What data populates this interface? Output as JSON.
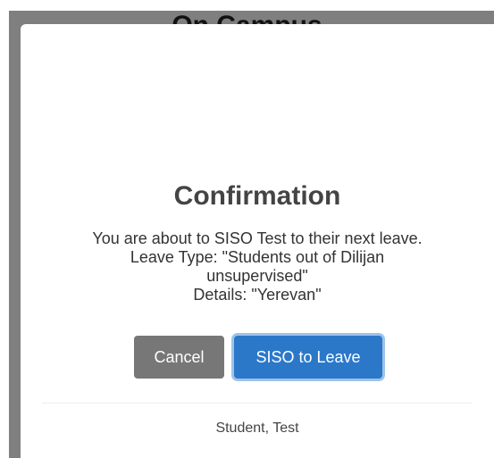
{
  "background": {
    "title": "On Campus"
  },
  "dialog": {
    "icon": "info-icon",
    "icon_color": "#9fd6ee",
    "title": "Confirmation",
    "message_lines": [
      "You are about to SISO Test to their next leave.",
      "Leave Type: \"Students out of Dilijan",
      "unsupervised\"",
      "Details: \"Yerevan\""
    ],
    "cancel_label": "Cancel",
    "confirm_label": "SISO to Leave",
    "confirm_color": "#2b78c9",
    "cancel_color": "#777777",
    "footer": "Student, Test"
  }
}
